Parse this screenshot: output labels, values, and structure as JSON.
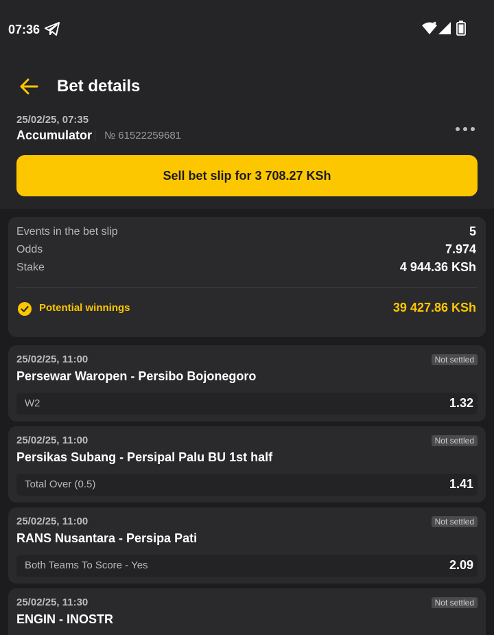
{
  "status_bar": {
    "time": "07:36"
  },
  "header": {
    "title": "Bet details"
  },
  "bet": {
    "datetime": "25/02/25, 07:35",
    "type": "Accumulator",
    "number": "№ 61522259681",
    "sell_label": "Sell bet slip for 3 708.27 KSh"
  },
  "summary": {
    "events_label": "Events in the bet slip",
    "events_value": "5",
    "odds_label": "Odds",
    "odds_value": "7.974",
    "stake_label": "Stake",
    "stake_value": "4 944.36 KSh",
    "winnings_label": "Potential winnings",
    "winnings_value": "39 427.86 KSh"
  },
  "events": [
    {
      "datetime": "25/02/25, 11:00",
      "status": "Not settled",
      "title": "Persewar Waropen - Persibo Bojonegoro",
      "market": "W2",
      "odds": "1.32"
    },
    {
      "datetime": "25/02/25, 11:00",
      "status": "Not settled",
      "title": "Persikas Subang - Persipal Palu BU 1st half",
      "market": "Total Over (0.5)",
      "odds": "1.41"
    },
    {
      "datetime": "25/02/25, 11:00",
      "status": "Not settled",
      "title": "RANS Nusantara - Persipa Pati",
      "market": "Both Teams To Score - Yes",
      "odds": "2.09"
    },
    {
      "datetime": "25/02/25, 11:30",
      "status": "Not settled",
      "title": "ENGIN - INOSTR",
      "market": "",
      "odds": ""
    }
  ],
  "colors": {
    "accent": "#fdc700",
    "background": "#1c1c1e",
    "card": "#2a2a2c"
  }
}
